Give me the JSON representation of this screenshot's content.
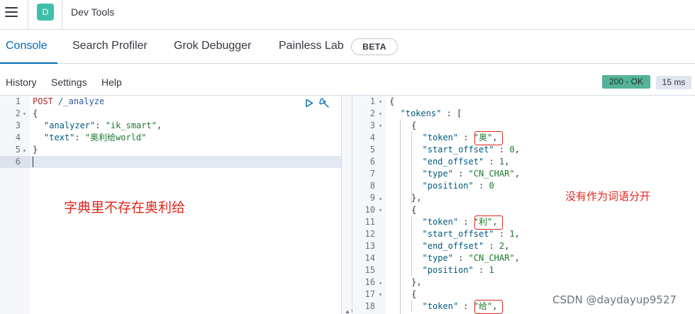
{
  "header": {
    "space_initial": "D",
    "title": "Dev Tools"
  },
  "tabs": {
    "items": [
      "Console",
      "Search Profiler",
      "Grok Debugger",
      "Painless Lab"
    ],
    "beta_label": "BETA"
  },
  "toolbar": {
    "history": "History",
    "settings": "Settings",
    "help": "Help",
    "status": "200 - OK",
    "time": "15 ms"
  },
  "request": {
    "line_numbers": [
      "1",
      "2",
      "3",
      "4",
      "5",
      "6"
    ],
    "lines": [
      {
        "method": "POST",
        "path": "/_analyze"
      },
      {
        "text": "{"
      },
      {
        "key": "\"analyzer\"",
        "sep": ": ",
        "value": "\"ik_smart\"",
        "end": ","
      },
      {
        "key": "\"text\"",
        "sep": ": ",
        "value": "\"奥利给world\"",
        "end": ""
      },
      {
        "text": "}"
      },
      {
        "text": ""
      }
    ]
  },
  "response": {
    "line_numbers": [
      "1",
      "2",
      "3",
      "4",
      "5",
      "6",
      "7",
      "8",
      "9",
      "10",
      "11",
      "12",
      "13",
      "14",
      "15",
      "16",
      "17",
      "18"
    ],
    "lines": [
      {
        "text": "{"
      },
      {
        "key": "\"tokens\"",
        "sep": " : ",
        "end": "["
      },
      {
        "text": "{"
      },
      {
        "key": "\"token\"",
        "sep": " : ",
        "value": "\"奥\"",
        "end": ","
      },
      {
        "key": "\"start_offset\"",
        "sep": " : ",
        "value": "0",
        "end": ","
      },
      {
        "key": "\"end_offset\"",
        "sep": " : ",
        "value": "1",
        "end": ","
      },
      {
        "key": "\"type\"",
        "sep": " : ",
        "value": "\"CN_CHAR\"",
        "end": ","
      },
      {
        "key": "\"position\"",
        "sep": " : ",
        "value": "0",
        "end": ""
      },
      {
        "text": "},"
      },
      {
        "text": "{"
      },
      {
        "key": "\"token\"",
        "sep": " : ",
        "value": "\"利\"",
        "end": ","
      },
      {
        "key": "\"start_offset\"",
        "sep": " : ",
        "value": "1",
        "end": ","
      },
      {
        "key": "\"end_offset\"",
        "sep": " : ",
        "value": "2",
        "end": ","
      },
      {
        "key": "\"type\"",
        "sep": " : ",
        "value": "\"CN_CHAR\"",
        "end": ","
      },
      {
        "key": "\"position\"",
        "sep": " : ",
        "value": "1",
        "end": ""
      },
      {
        "text": "},"
      },
      {
        "text": "{"
      },
      {
        "key": "\"token\"",
        "sep": " : ",
        "value": "\"给\"",
        "end": ","
      }
    ]
  },
  "annotations": {
    "left": "字典里不存在奥利给",
    "right": "没有作为词语分开"
  },
  "watermark": "CSDN @daydayup9527",
  "colors": {
    "accent": "#006bb8",
    "status_ok": "#54b399",
    "annotation_red": "#e0271d"
  }
}
